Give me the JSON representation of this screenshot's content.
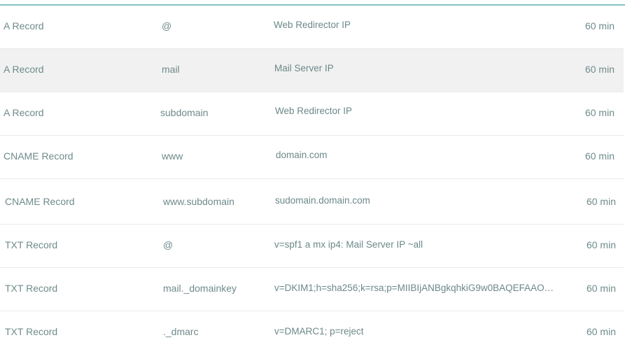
{
  "records": [
    {
      "type": "A Record",
      "host": "@",
      "value": "Web Redirector IP",
      "ttl": "60 min"
    },
    {
      "type": "A Record",
      "host": "mail",
      "value": "Mail Server IP",
      "ttl": "60 min"
    },
    {
      "type": "A Record",
      "host": "subdomain",
      "value": "Web Redirector IP",
      "ttl": "60 min"
    },
    {
      "type": "CNAME Record",
      "host": "www",
      "value": "domain.com",
      "ttl": "60 min"
    },
    {
      "type": "CNAME Record",
      "host": "www.subdomain",
      "value": "sudomain.domain.com",
      "ttl": "60 min"
    },
    {
      "type": "TXT Record",
      "host": "@",
      "value": "v=spf1 a mx ip4: Mail Server IP ~all",
      "ttl": "60 min"
    },
    {
      "type": "TXT Record",
      "host": "mail._domainkey",
      "value": "v=DKIM1;h=sha256;k=rsa;p=MIIBIjANBgkqhkiG9w0BAQEFAAO…",
      "ttl": "60 min"
    },
    {
      "type": "TXT Record",
      "host": "._dmarc",
      "value": "v=DMARC1; p=reject",
      "ttl": "60 min"
    }
  ]
}
